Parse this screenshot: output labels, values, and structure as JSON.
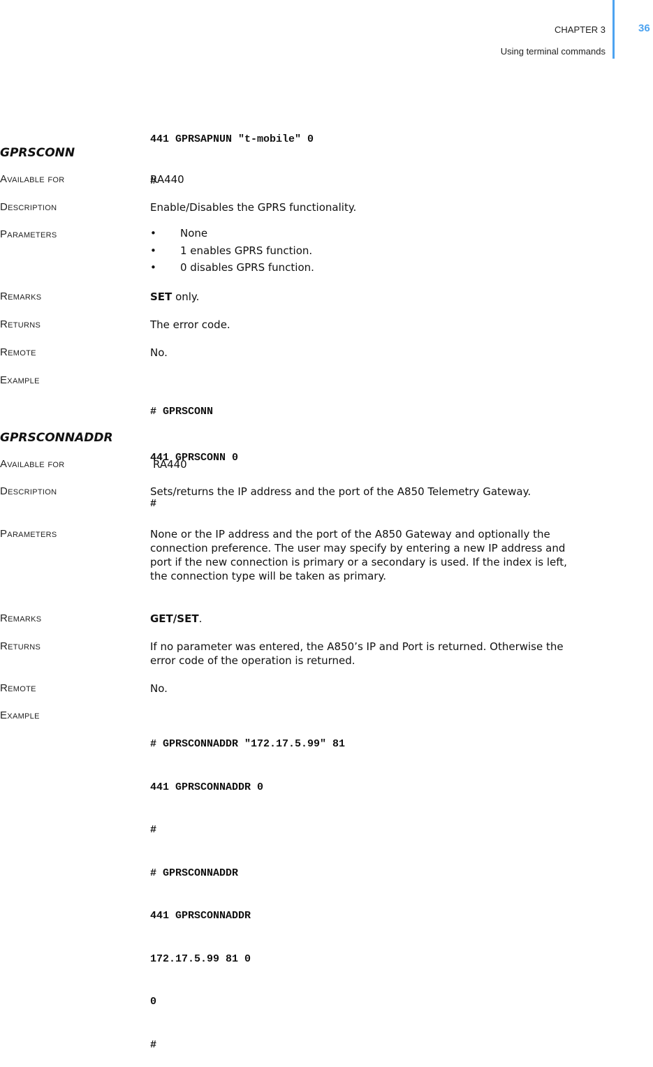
{
  "header": {
    "chapter": "CHAPTER 3",
    "subtitle": "Using terminal commands",
    "page_number": "36",
    "accent_color": "#4da3f0"
  },
  "prev_example_tail": [
    "441 GPRSAPNUN \"t-mobile\" 0",
    "#"
  ],
  "sections": [
    {
      "title": "GPRSCONN",
      "available_label": "Available for",
      "available": "RA440",
      "description_label": "Description",
      "description": "Enable/Disables the GPRS functionality.",
      "parameters_label": "Parameters",
      "parameters": [
        "None",
        "1 enables GPRS function.",
        "0 disables GPRS function."
      ],
      "remarks_label": "Remarks",
      "remarks_bold": "SET",
      "remarks_rest": " only.",
      "returns_label": "Returns",
      "returns": "The error code.",
      "remote_label": "Remote",
      "remote": "No.",
      "example_label": "Example",
      "example": [
        "# GPRSCONN",
        "441 GPRSCONN 0",
        "#"
      ]
    },
    {
      "title": "GPRSCONNADDR",
      "available_label": "Available for",
      "available": "RA440",
      "description_label": "Description",
      "description": "Sets/returns the IP address and the port of the A850 Telemetry Gateway.",
      "parameters_label": "Parameters",
      "parameters": "None or the IP address and the port of the A850 Gateway and optionally the connection preference. The user may specify by entering a new IP address and port if the new connection is primary or a secondary is used. If the index is left, the connection type will be taken as primary.",
      "remarks_label": "Remarks",
      "remarks_bold": "GET/SET",
      "remarks_rest": ".",
      "returns_label": "Returns",
      "returns": "If no parameter was entered, the A850’s IP and Port is returned. Otherwise the error code of the operation is returned.",
      "remote_label": "Remote",
      "remote": "No.",
      "example_label": "Example",
      "example": [
        "# GPRSCONNADDR \"172.17.5.99\" 81",
        "441 GPRSCONNADDR 0",
        "#",
        "# GPRSCONNADDR",
        "441 GPRSCONNADDR",
        "172.17.5.99 81 0",
        "0",
        "#"
      ]
    }
  ]
}
